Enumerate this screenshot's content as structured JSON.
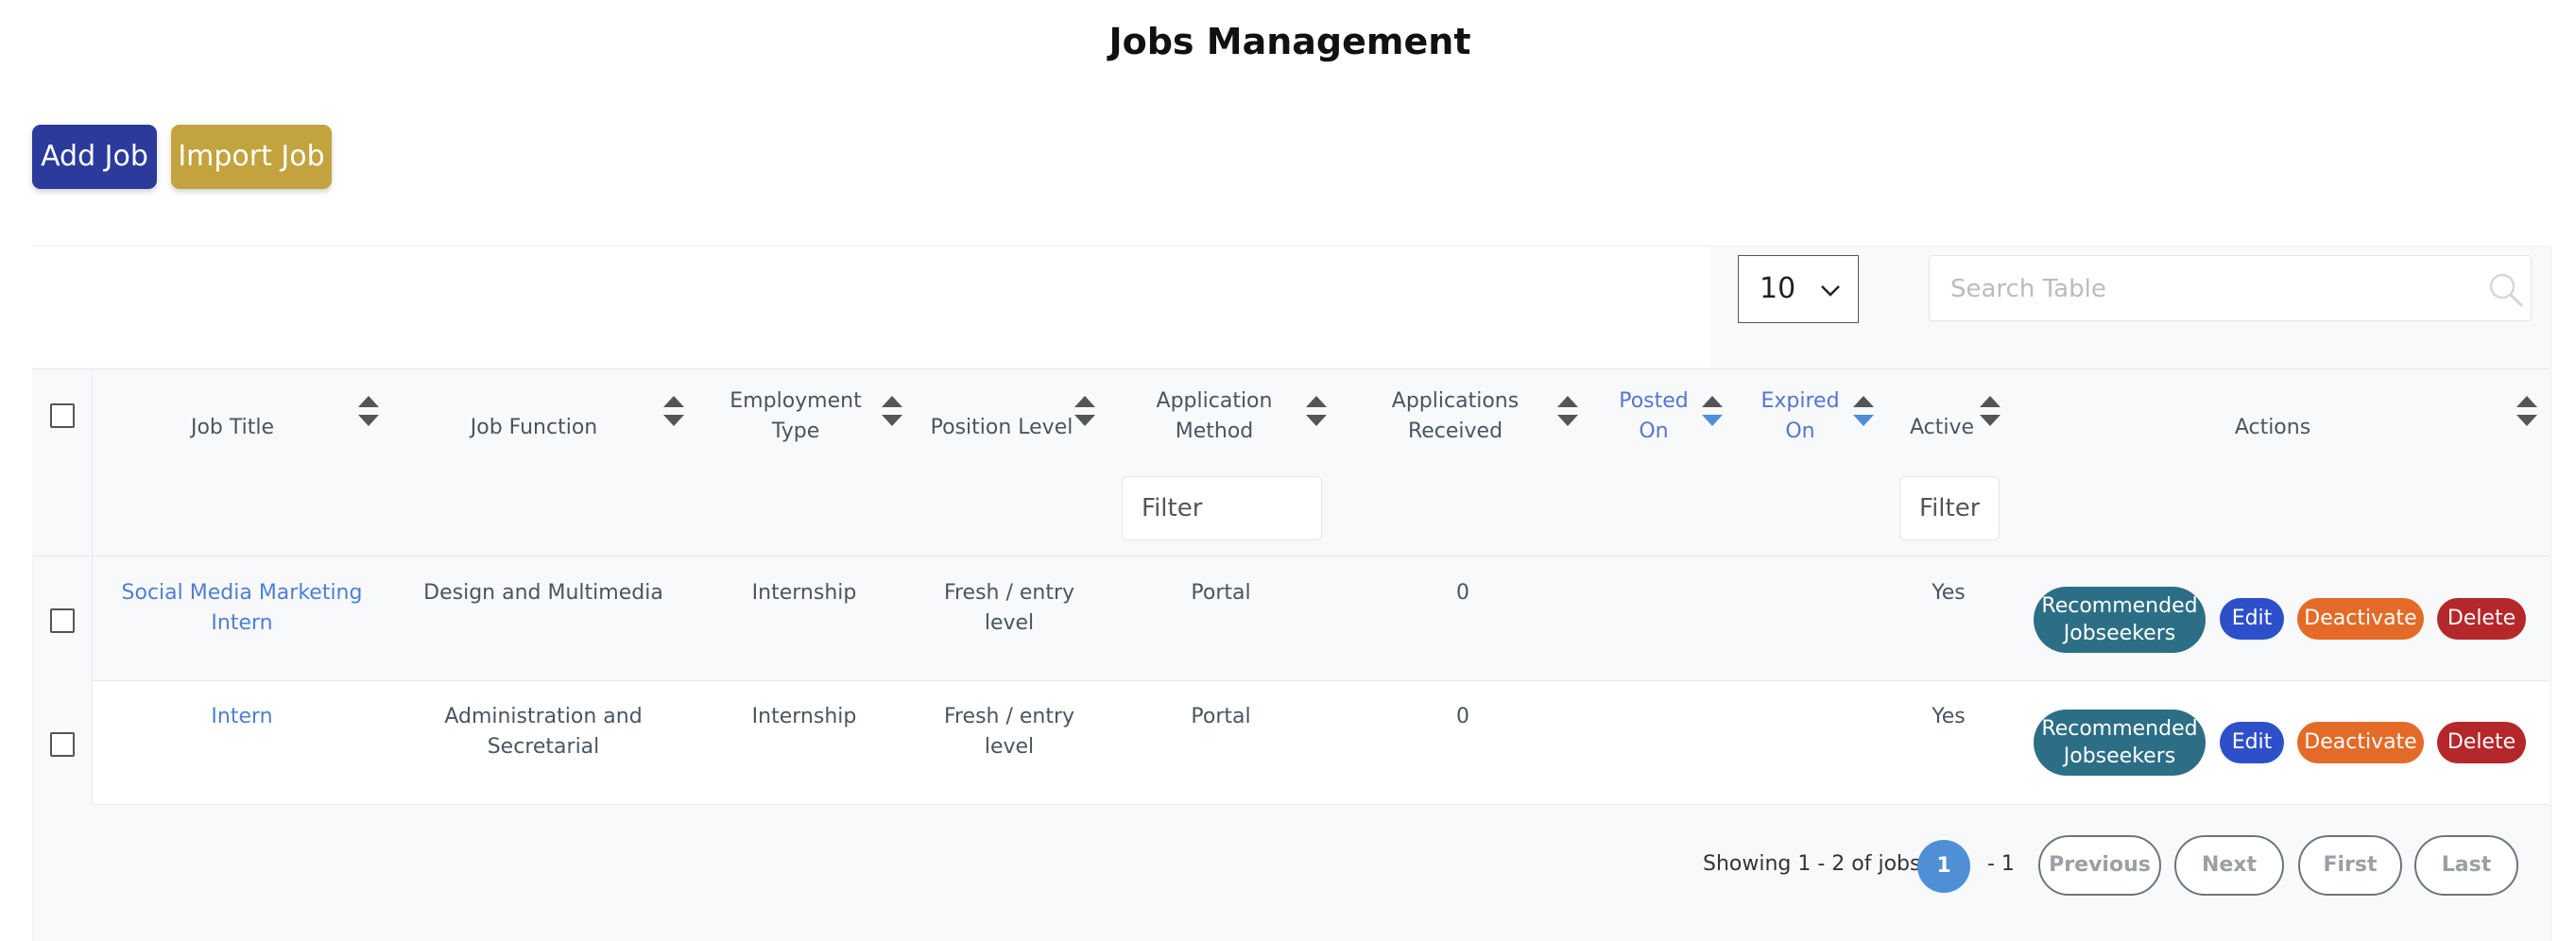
{
  "page": {
    "title": "Jobs Management"
  },
  "toolbar": {
    "add_label": "Add Job",
    "import_label": "Import Job"
  },
  "table_controls": {
    "per_page": "10",
    "search_placeholder": "Search Table"
  },
  "columns": [
    {
      "label": "Job Title"
    },
    {
      "label": "Job Function"
    },
    {
      "label": "Employment Type"
    },
    {
      "label": "Position Level"
    },
    {
      "label": "Application Method"
    },
    {
      "label": "Applications Received"
    },
    {
      "label": "Posted On"
    },
    {
      "label": "Expired On"
    },
    {
      "label": "Active"
    },
    {
      "label": "Actions"
    }
  ],
  "filters": {
    "application_method_placeholder": "Filter",
    "active_placeholder": "Filter"
  },
  "rows": [
    {
      "job_title": "Social Media Marketing Intern",
      "job_function": "Design and Multimedia",
      "employment_type": "Internship",
      "position_level": "Fresh / entry level",
      "application_method": "Portal",
      "applications_received": "0",
      "active": "Yes"
    },
    {
      "job_title": "Intern",
      "job_function": "Administration and Secretarial",
      "employment_type": "Internship",
      "position_level": "Fresh / entry level",
      "application_method": "Portal",
      "applications_received": "0",
      "active": "Yes"
    }
  ],
  "actions": {
    "recommended": "Recommended Jobseekers",
    "edit": "Edit",
    "deactivate": "Deactivate",
    "delete": "Delete"
  },
  "pagination": {
    "showing": "Showing 1 - 2 of jobs",
    "current_page": "1",
    "total": "- 1",
    "previous": "Previous",
    "next": "Next",
    "first": "First",
    "last": "Last"
  },
  "colors": {
    "add_button": "#2b3a9b",
    "import_button": "#c3a33d",
    "link": "#4f7fd2",
    "recommended": "#2c6e86",
    "edit": "#2d4fc9",
    "deactivate": "#e46a28",
    "delete": "#b4272a",
    "page_active": "#4e8fd6"
  }
}
